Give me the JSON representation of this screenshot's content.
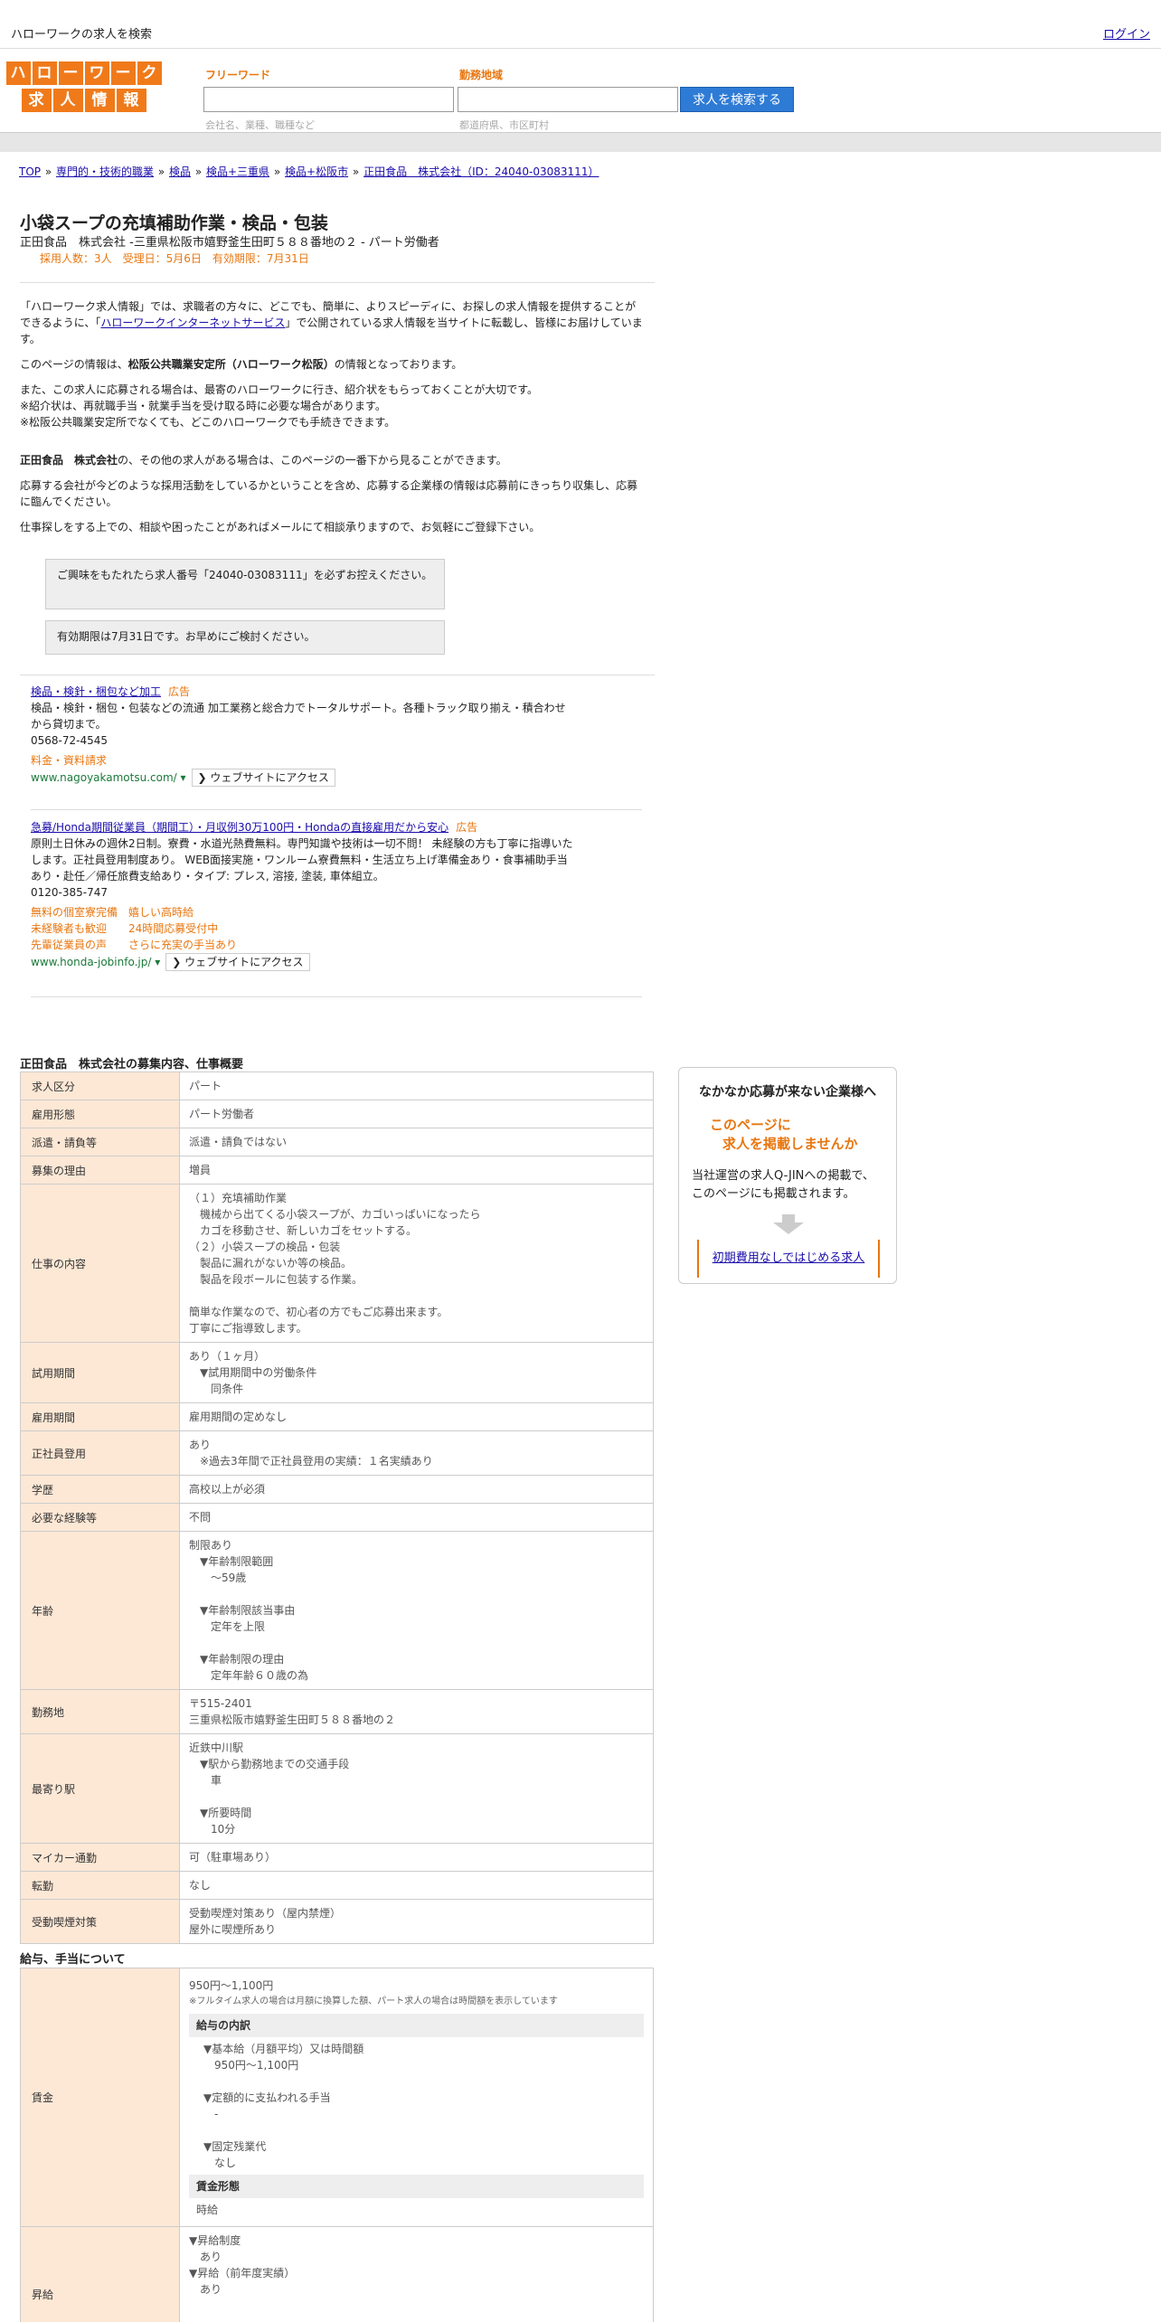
{
  "topbar": {
    "title": "ハローワークの求人を検索",
    "login": "ログイン"
  },
  "logo": {
    "row1": [
      "ハ",
      "ロ",
      "ー",
      "ワ",
      "ー",
      "ク"
    ],
    "row2": [
      "求",
      "人",
      "情",
      "報"
    ]
  },
  "search": {
    "freeword_label": "フリーワード",
    "freeword_hint": "会社名、業種、職種など",
    "area_label": "勤務地域",
    "area_hint": "都道府県、市区町村",
    "button": "求人を検索する"
  },
  "breadcrumb": [
    "TOP",
    "専門的・技術的職業",
    "検品",
    "検品+三重県",
    "検品+松阪市",
    "正田食品　株式会社（ID：24040-03083111）"
  ],
  "job": {
    "title": "小袋スープの充填補助作業・検品・包装",
    "subtitle": "正田食品　株式会社 -三重県松阪市嬉野釜生田町５８８番地の２ - パート労働者",
    "meta": "採用人数：3人　受理日：5月6日　有効期限：7月31日"
  },
  "intro": {
    "p1a": "「ハローワーク求人情報」では、求職者の方々に、どこでも、簡単に、よりスピーディに、お探しの求人情報を提供することができるように、「",
    "p1link": "ハローワークインターネットサービス",
    "p1b": "」で公開されている求人情報を当サイトに転載し、皆様にお届けしています。",
    "p2a": "このページの情報は、",
    "p2b": "松阪公共職業安定所（ハローワーク松阪）",
    "p2c": "の情報となっております。",
    "p3": "また、この求人に応募される場合は、最寄のハローワークに行き、紹介状をもらっておくことが大切です。",
    "p4": "※紹介状は、再就職手当・就業手当を受け取る時に必要な場合があります。",
    "p5": "※松阪公共職業安定所でなくても、どこのハローワークでも手続きできます。",
    "p6a": "正田食品　株式会社",
    "p6b": "の、その他の求人がある場合は、このページの一番下から見ることができます。",
    "p7": "応募する会社が今どのような採用活動をしているかということを含め、応募する企業様の情報は応募前にきっちり収集し、応募に臨んでください。",
    "p8": "仕事探しをする上での、相談や困ったことがあればメールにて相談承りますので、お気軽にご登録下さい。"
  },
  "notices": [
    "ご興味をもたれたら求人番号「24040-03083111」を必ずお控えください。",
    "有効期限は7月31日です。お早めにご検討ください。"
  ],
  "ads": [
    {
      "title": "検品・検針・梱包など加工",
      "label": "広告",
      "body": "検品・検針・梱包・包装などの流通 加工業務と総合力でトータルサポート。各種トラック取り揃え・積合わせから貸切まで。",
      "phone": "0568-72-4545",
      "extras": [
        "料金・資料請求"
      ],
      "url": "www.nagoyakamotsu.com/",
      "visit": "ウェブサイトにアクセス"
    },
    {
      "title": "急募/Honda期間従業員（期間工）・月収例30万100円・Hondaの直接雇用だから安心",
      "label": "広告",
      "body": "原則土日休みの週休2日制。寮費・水道光熱費無料。専門知識や技術は一切不問！ 未経験の方も丁寧に指導いたします。正社員登用制度あり。 WEB面接実施・ワンルーム寮費無料・生活立ち上げ準備金あり・食事補助手当あり・赴任／帰任旅費支給あり・タイプ: プレス, 溶接, 塗装, 車体組立。",
      "phone": "0120-385-747",
      "extras": [
        "無料の個室寮完備　嬉しい高時給",
        "未経験者も歓迎　　24時間応募受付中",
        "先輩従業員の声　　さらに充実の手当あり"
      ],
      "url": "www.honda-jobinfo.jp/",
      "visit": "ウェブサイトにアクセス"
    }
  ],
  "section1": {
    "heading": "正田食品　株式会社の募集内容、仕事概要",
    "rows": [
      {
        "k": "求人区分",
        "v": "パート"
      },
      {
        "k": "雇用形態",
        "v": "パート労働者"
      },
      {
        "k": "派遣・請負等",
        "v": "派遣・請負ではない"
      },
      {
        "k": "募集の理由",
        "v": "増員"
      },
      {
        "k": "仕事の内容",
        "v": "（１）充填補助作業\n　機械から出てくる小袋スープが、カゴいっぱいになったら\n　カゴを移動させ、新しいカゴをセットする。\n（２）小袋スープの検品・包装\n　製品に漏れがないか等の検品。\n　製品を段ボールに包装する作業。\n\n簡単な作業なので、初心者の方でもご応募出来ます。\n丁寧にご指導致します。"
      },
      {
        "k": "試用期間",
        "v": "あり（１ヶ月）\n　▼試用期間中の労働条件\n　　同条件"
      },
      {
        "k": "雇用期間",
        "v": "雇用期間の定めなし"
      },
      {
        "k": "正社員登用",
        "v": "あり\n　※過去3年間で正社員登用の実績：１名実績あり"
      },
      {
        "k": "学歴",
        "v": "高校以上が必須"
      },
      {
        "k": "必要な経験等",
        "v": "不問"
      },
      {
        "k": "年齢",
        "v": "制限あり\n　▼年齢制限範囲\n　　〜59歳\n\n　▼年齢制限該当事由\n　　定年を上限\n\n　▼年齢制限の理由\n　　定年年齢６０歳の為"
      },
      {
        "k": "勤務地",
        "v": "〒515-2401\n三重県松阪市嬉野釜生田町５８８番地の２"
      },
      {
        "k": "最寄り駅",
        "v": "近鉄中川駅\n　▼駅から勤務地までの交通手段\n　　車\n\n　▼所要時間\n　　10分"
      },
      {
        "k": "マイカー通勤",
        "v": "可（駐車場あり）"
      },
      {
        "k": "転勤",
        "v": "なし"
      },
      {
        "k": "受動喫煙対策",
        "v": "受動喫煙対策あり（屋内禁煙）\n屋外に喫煙所あり"
      }
    ]
  },
  "section2": {
    "heading": "給与、手当について",
    "wage_label": "賃金",
    "wage_main": "950円〜1,100円",
    "wage_note": "※フルタイム求人の場合は月額に換算した額、パート求人の場合は時間額を表示しています",
    "breakdown_h": "給与の内訳",
    "breakdown": "　▼基本給（月額平均）又は時間額\n　　950円〜1,100円\n\n　▼定額的に支払われる手当\n　　-\n\n　▼固定残業代\n　　なし",
    "form_h": "賃金形態",
    "form_v": "時給",
    "raise_label": "昇給",
    "raise": "▼昇給制度\n　あり\n▼昇給（前年度実績）\n　あり"
  },
  "sidebox": {
    "heading": "なかなか応募が来ない企業様へ",
    "orange1": "このページに",
    "orange2": "求人を掲載しませんか",
    "body": "当社運営の求人Q-JINへの掲載で、このページにも掲載されます。",
    "link": "初期費用なしではじめる求人"
  }
}
